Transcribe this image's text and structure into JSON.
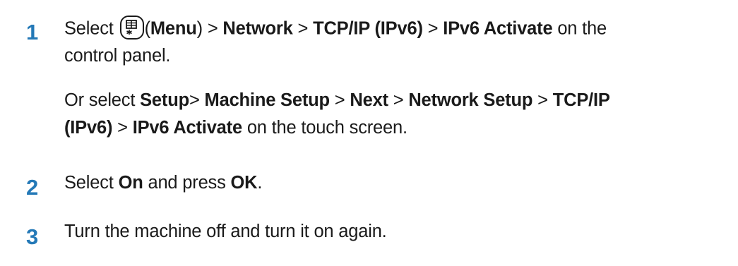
{
  "steps": [
    {
      "number": "1",
      "line1": {
        "select": "Select ",
        "icon": "menu-icon",
        "open_paren": "(",
        "menu": "Menu",
        "close_paren": ")",
        "sep1": " > ",
        "network": "Network",
        "sep2": " > ",
        "tcpip": "TCP/IP (IPv6)",
        "sep3": " > ",
        "activate": "IPv6 Activate",
        "tail": " on the"
      },
      "line2": "control panel.",
      "alt_line1": {
        "or_select": "Or select ",
        "setup": "Setup",
        "sep0": "> ",
        "machine_setup": "Machine Setup",
        "sep1": " > ",
        "next": "Next",
        "sep2": " > ",
        "network_setup": "Network Setup",
        "sep3": " > ",
        "tcpip": "TCP/IP"
      },
      "alt_line2": {
        "ipv6": "(IPv6)",
        "sep": " > ",
        "activate": "IPv6 Activate",
        "tail": " on the touch screen."
      }
    },
    {
      "number": "2",
      "select": "Select ",
      "on": "On",
      "and_press": " and press ",
      "ok": "OK",
      "period": "."
    },
    {
      "number": "3",
      "text": "Turn the machine off and turn it on again."
    }
  ],
  "colors": {
    "step_number": "#2479b7",
    "text": "#1a1a1a"
  }
}
